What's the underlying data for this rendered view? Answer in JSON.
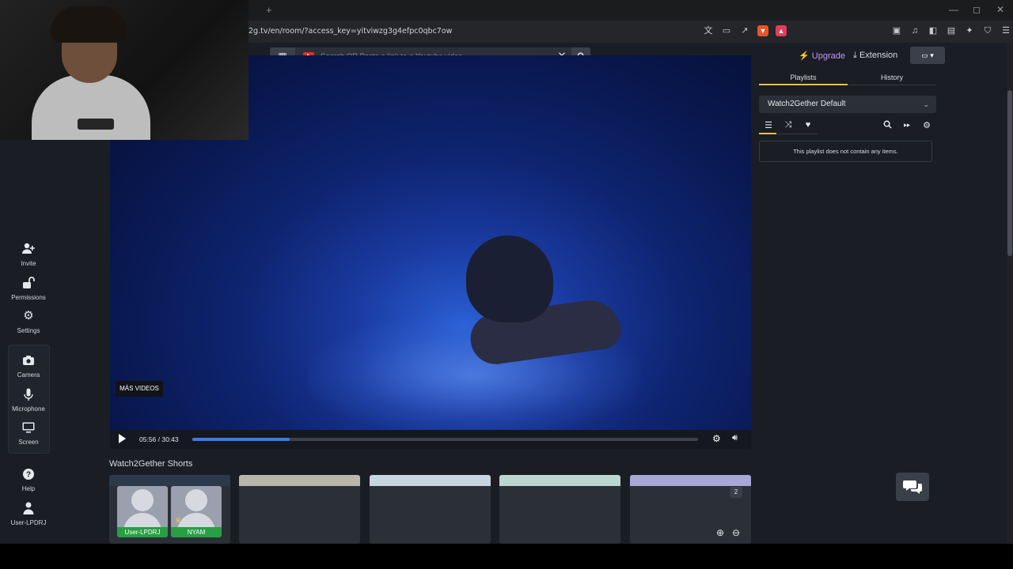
{
  "browser": {
    "url": "2g.tv/en/room/?access_key=yitviwzg3g4efpc0qbc7ow",
    "new_tab": "+",
    "window_controls": [
      "—",
      "◻",
      "✕"
    ]
  },
  "sidebar": {
    "invite": "Invite",
    "permissions": "Permissions",
    "settings": "Settings",
    "camera": "Camera",
    "microphone": "Microphone",
    "screen": "Screen",
    "help": "Help",
    "user": "User-LPDRJ"
  },
  "search": {
    "placeholder": "Search OR Paste a link to a Youtube video"
  },
  "header": {
    "upgrade": "Upgrade",
    "extension": "Extension"
  },
  "player": {
    "overlay_label": "MÁS VIDEOS",
    "timecode": "05:56 / 30:43",
    "progress": 0.193
  },
  "shorts": {
    "title": "Watch2Gether Shorts",
    "badge": "2",
    "thumbnails": [
      {
        "sky": "#2b3a4a"
      },
      {
        "sky": "#b9b6aa"
      },
      {
        "sky": "#c8d6e2"
      },
      {
        "sky": "#bcd7cf"
      },
      {
        "sky": "#a9a6d8"
      }
    ]
  },
  "users": [
    {
      "name": "User-LPDRJ"
    },
    {
      "name": "NYAM"
    }
  ],
  "right_panel": {
    "tabs": [
      "Playlists",
      "History"
    ],
    "active_tab": "Playlists",
    "playlist_name": "Watch2Gether Default",
    "empty_message": "This playlist does not contain any items."
  },
  "colors": {
    "accent": "#e0c24a",
    "upgrade": "#c495ff",
    "progress": "#3d7be8",
    "user_badge": "#26a043"
  },
  "icons": [
    "user-plus-icon",
    "lock-open-icon",
    "gear-icon",
    "camera-icon",
    "microphone-icon",
    "monitor-icon",
    "help-icon",
    "user-icon",
    "grid-icon",
    "youtube-icon",
    "close-icon",
    "search-icon",
    "download-icon",
    "list-icon",
    "shuffle-icon",
    "heart-icon",
    "fast-forward-icon",
    "zoom-in-icon",
    "zoom-out-icon",
    "chat-icon",
    "play-icon",
    "volume-icon"
  ]
}
